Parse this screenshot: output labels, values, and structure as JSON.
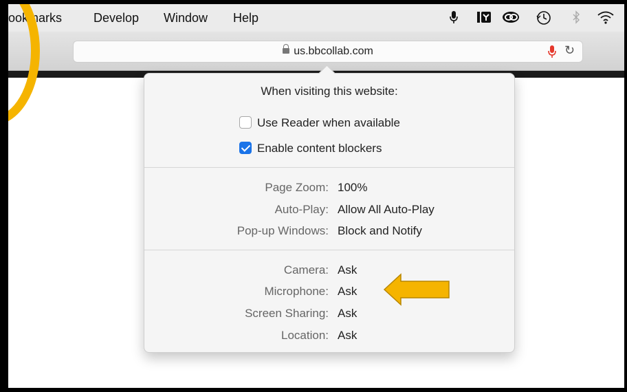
{
  "menubar": {
    "items": [
      "ookmarks",
      "Develop",
      "Window",
      "Help"
    ],
    "status_icons": [
      "microphone-icon",
      "network-icon",
      "creative-cloud-icon",
      "time-machine-icon",
      "bluetooth-icon",
      "wifi-icon"
    ]
  },
  "toolbar": {
    "url": "us.bbcollab.com",
    "icons": [
      "lock-icon",
      "microphone-icon",
      "reload-icon"
    ],
    "mic_color": "#e5382c"
  },
  "popover": {
    "title": "When visiting this website:",
    "checkboxes": [
      {
        "label": "Use Reader when available",
        "checked": false
      },
      {
        "label": "Enable content blockers",
        "checked": true
      }
    ],
    "settings": [
      {
        "label": "Page Zoom:",
        "value": "100%"
      },
      {
        "label": "Auto-Play:",
        "value": "Allow All Auto-Play"
      },
      {
        "label": "Pop-up Windows:",
        "value": "Block and Notify"
      }
    ],
    "permissions": [
      {
        "label": "Camera:",
        "value": "Ask"
      },
      {
        "label": "Microphone:",
        "value": "Ask"
      },
      {
        "label": "Screen Sharing:",
        "value": "Ask"
      },
      {
        "label": "Location:",
        "value": "Ask"
      }
    ]
  },
  "annotation": {
    "arrow_color": "#f5b400",
    "ring_color": "#f5b400"
  }
}
